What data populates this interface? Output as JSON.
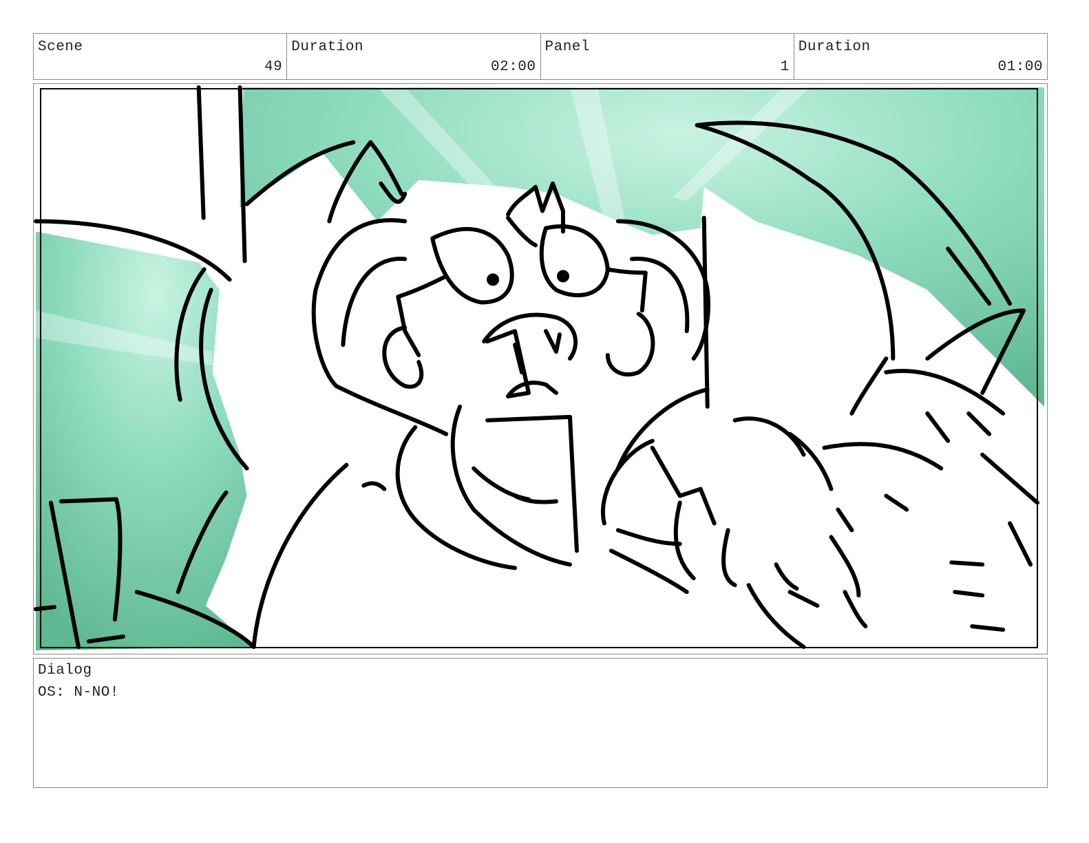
{
  "header": {
    "scene_label": "Scene",
    "scene_value": "49",
    "scene_duration_label": "Duration",
    "scene_duration_value": "02:00",
    "panel_label": "Panel",
    "panel_value": "1",
    "panel_duration_label": "Duration",
    "panel_duration_value": "01:00"
  },
  "panel_art": {
    "background_color": "#8fdcbf",
    "background_dark_color": "#5fb893",
    "line_color": "#000000"
  },
  "dialog": {
    "label": "Dialog",
    "text": "OS: N-NO!"
  }
}
